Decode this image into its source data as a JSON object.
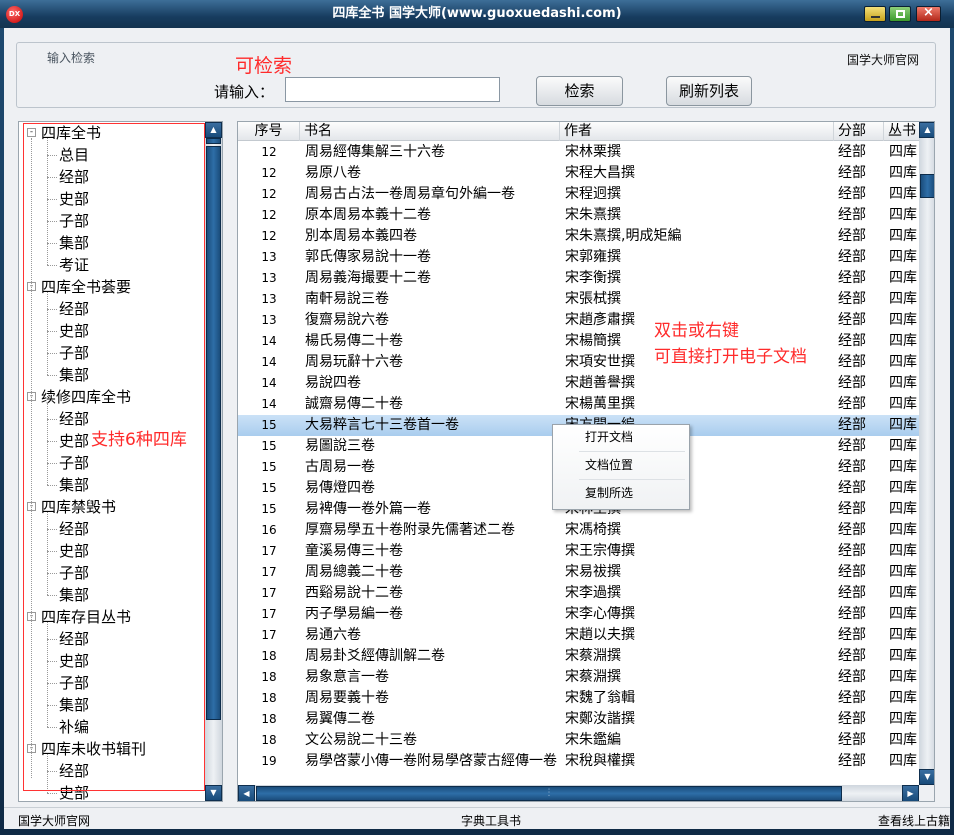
{
  "window": {
    "app_icon": "DX",
    "title": "四库全书   国学大师(www.guoxuedashi.com)",
    "buttons": [
      "minimize-icon",
      "maximize-icon",
      "close-icon"
    ]
  },
  "search": {
    "group_label": "输入检索",
    "site_label": "国学大师官网",
    "annotation": "可检索",
    "input_label": "请输入：",
    "input_value": "",
    "search_button": "检索",
    "refresh_button": "刷新列表"
  },
  "tree": {
    "annotation": "支持6种四库",
    "nodes": [
      {
        "label": "四库全书",
        "level": 0,
        "expand": "-"
      },
      {
        "label": "总目",
        "level": 1
      },
      {
        "label": "经部",
        "level": 1
      },
      {
        "label": "史部",
        "level": 1
      },
      {
        "label": "子部",
        "level": 1
      },
      {
        "label": "集部",
        "level": 1
      },
      {
        "label": "考证",
        "level": 1
      },
      {
        "label": "四库全书荟要",
        "level": 0,
        "expand": "-"
      },
      {
        "label": "经部",
        "level": 1
      },
      {
        "label": "史部",
        "level": 1
      },
      {
        "label": "子部",
        "level": 1
      },
      {
        "label": "集部",
        "level": 1
      },
      {
        "label": "续修四库全书",
        "level": 0,
        "expand": "-"
      },
      {
        "label": "经部",
        "level": 1
      },
      {
        "label": "史部",
        "level": 1
      },
      {
        "label": "子部",
        "level": 1
      },
      {
        "label": "集部",
        "level": 1
      },
      {
        "label": "四库禁毁书",
        "level": 0,
        "expand": "-"
      },
      {
        "label": "经部",
        "level": 1
      },
      {
        "label": "史部",
        "level": 1
      },
      {
        "label": "子部",
        "level": 1
      },
      {
        "label": "集部",
        "level": 1
      },
      {
        "label": "四库存目丛书",
        "level": 0,
        "expand": "-"
      },
      {
        "label": "经部",
        "level": 1
      },
      {
        "label": "史部",
        "level": 1
      },
      {
        "label": "子部",
        "level": 1
      },
      {
        "label": "集部",
        "level": 1
      },
      {
        "label": "补编",
        "level": 1
      },
      {
        "label": "四库未收书辑刊",
        "level": 0,
        "expand": "-"
      },
      {
        "label": "经部",
        "level": 1
      },
      {
        "label": "史部",
        "level": 1
      }
    ]
  },
  "grid": {
    "columns": [
      "序号",
      "书名",
      "作者",
      "分部",
      "丛书"
    ],
    "annotation": "双击或右键\n可直接打开电子文档",
    "rows": [
      [
        "12",
        "周易經傳集解三十六卷",
        "宋林栗撰",
        "经部",
        "四库"
      ],
      [
        "12",
        "易原八卷",
        "宋程大昌撰",
        "经部",
        "四库"
      ],
      [
        "12",
        "周易古占法一卷周易章句外編一卷",
        "宋程迥撰",
        "经部",
        "四库"
      ],
      [
        "12",
        "原本周易本義十二卷",
        "宋朱熹撰",
        "经部",
        "四库"
      ],
      [
        "12",
        "別本周易本義四卷",
        "宋朱熹撰,明成矩編",
        "经部",
        "四库"
      ],
      [
        "13",
        "郭氏傳家易說十一卷",
        "宋郭雍撰",
        "经部",
        "四库"
      ],
      [
        "13",
        "周易義海撮要十二卷",
        "宋李衡撰",
        "经部",
        "四库"
      ],
      [
        "13",
        "南軒易說三卷",
        "宋張栻撰",
        "经部",
        "四库"
      ],
      [
        "13",
        "復齋易說六卷",
        "宋趙彥肅撰",
        "经部",
        "四库"
      ],
      [
        "14",
        "楊氏易傳二十卷",
        "宋楊簡撰",
        "经部",
        "四库"
      ],
      [
        "14",
        "周易玩辭十六卷",
        "宋項安世撰",
        "经部",
        "四库"
      ],
      [
        "14",
        "易說四卷",
        "宋趙善譽撰",
        "经部",
        "四库"
      ],
      [
        "14",
        "誠齋易傳二十卷",
        "宋楊萬里撰",
        "经部",
        "四库"
      ],
      [
        "15",
        "大易粹言七十三卷首一卷",
        "宋方聞一編",
        "经部",
        "四库"
      ],
      [
        "15",
        "易圖說三卷",
        "",
        "经部",
        "四库"
      ],
      [
        "15",
        "古周易一卷",
        "",
        "经部",
        "四库"
      ],
      [
        "15",
        "易傳燈四卷",
        "",
        "经部",
        "四库"
      ],
      [
        "15",
        "易裨傳一卷外篇一卷",
        "宋林至撰",
        "经部",
        "四库"
      ],
      [
        "16",
        "厚齋易學五十卷附录先儒著述二卷",
        "宋馮椅撰",
        "经部",
        "四库"
      ],
      [
        "17",
        "童溪易傳三十卷",
        "宋王宗傳撰",
        "经部",
        "四库"
      ],
      [
        "17",
        "周易總義二十卷",
        "宋易祓撰",
        "经部",
        "四库"
      ],
      [
        "17",
        "西谿易說十二卷",
        "宋李過撰",
        "经部",
        "四库"
      ],
      [
        "17",
        "丙子學易編一卷",
        "宋李心傳撰",
        "经部",
        "四库"
      ],
      [
        "17",
        "易通六卷",
        "宋趙以夫撰",
        "经部",
        "四库"
      ],
      [
        "18",
        "周易卦爻經傳訓解二卷",
        "宋蔡淵撰",
        "经部",
        "四库"
      ],
      [
        "18",
        "易象意言一卷",
        "宋蔡淵撰",
        "经部",
        "四库"
      ],
      [
        "18",
        "周易要義十卷",
        "宋魏了翁輯",
        "经部",
        "四库"
      ],
      [
        "18",
        "易翼傳二卷",
        "宋鄭汝諧撰",
        "经部",
        "四库"
      ],
      [
        "18",
        "文公易說二十三卷",
        "宋朱鑑編",
        "经部",
        "四库"
      ],
      [
        "19",
        "易學啓蒙小傳一卷附易學啓蒙古經傳一卷",
        "宋稅與權撰",
        "经部",
        "四库"
      ]
    ],
    "selected_row": 13
  },
  "context_menu": {
    "items": [
      "打开文档",
      "文档位置",
      "复制所选"
    ]
  },
  "status": {
    "left": "国学大师官网",
    "middle": "字典工具书",
    "right": "查看线上古籍"
  }
}
